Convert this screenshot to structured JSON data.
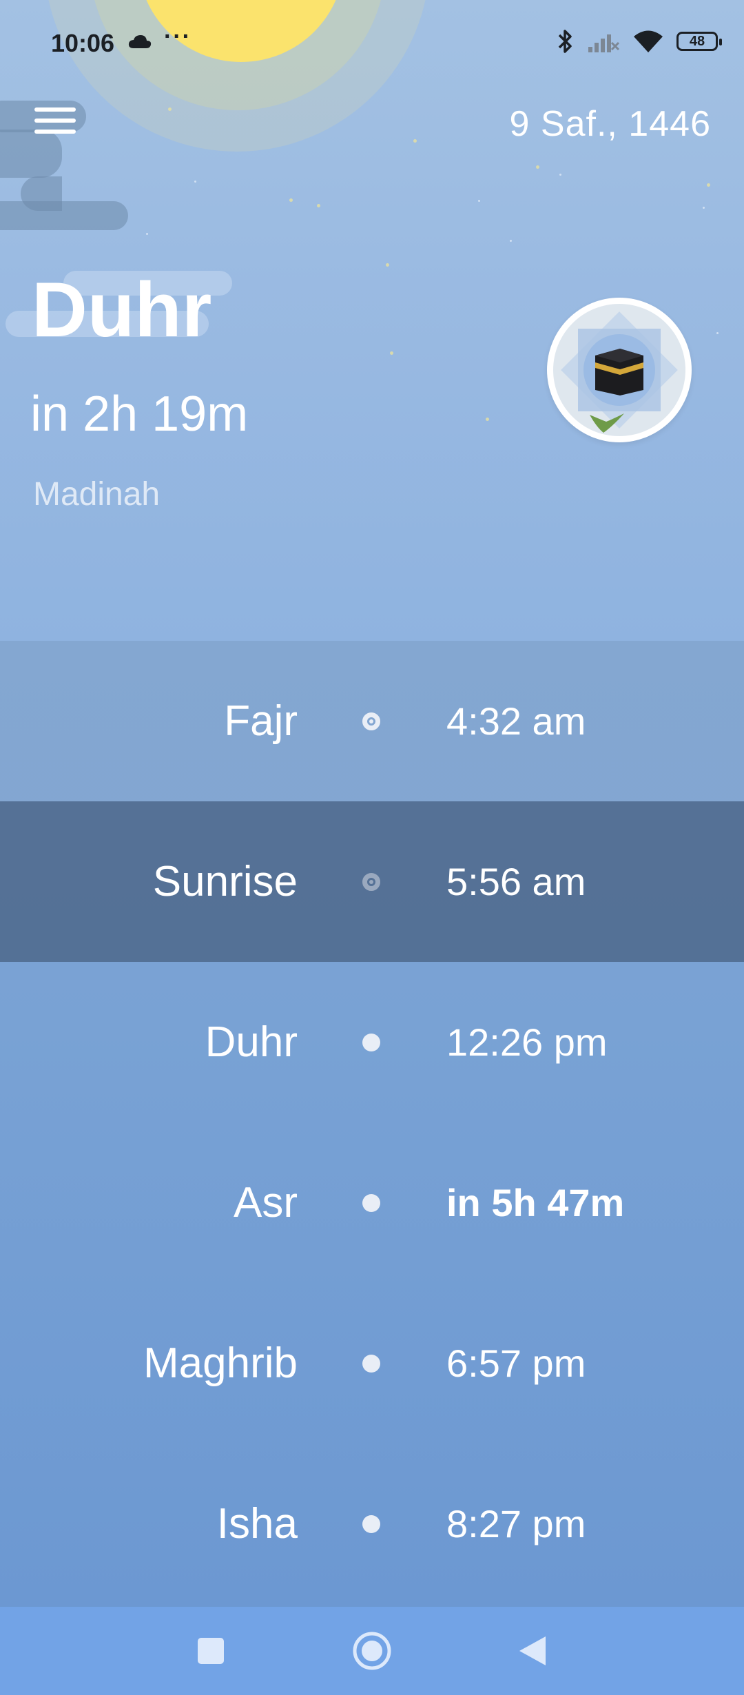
{
  "status_bar": {
    "time": "10:06",
    "more_indicator": "···",
    "battery_level": "48",
    "icons": [
      "cloud-icon",
      "bluetooth-icon",
      "signal-icon",
      "wifi-icon",
      "battery-icon"
    ]
  },
  "header": {
    "hijri_date": "9 Saf., 1446",
    "current_prayer": "Duhr",
    "countdown": "in 2h 19m",
    "location": "Madinah",
    "qibla_icon": "kaaba-icon"
  },
  "prayers": [
    {
      "name": "Fajr",
      "time": "4:32 am",
      "indicator": "ring"
    },
    {
      "name": "Sunrise",
      "time": "5:56 am",
      "indicator": "ring",
      "highlighted": true
    },
    {
      "name": "Duhr",
      "time": "12:26 pm",
      "indicator": "dot"
    },
    {
      "name": "Asr",
      "time": "in 5h 47m",
      "indicator": "dot",
      "bold": true
    },
    {
      "name": "Maghrib",
      "time": "6:57 pm",
      "indicator": "dot"
    },
    {
      "name": "Isha",
      "time": "8:27 pm",
      "indicator": "dot"
    }
  ],
  "nav_bar": {
    "icons": [
      "square-recents-icon",
      "circle-home-icon",
      "triangle-back-icon"
    ]
  },
  "colors": {
    "sun": "#fbe36d",
    "sky_top": "#a3c1e3",
    "highlight_row": "#5b7797",
    "nav_bar": "#72a3e6"
  }
}
